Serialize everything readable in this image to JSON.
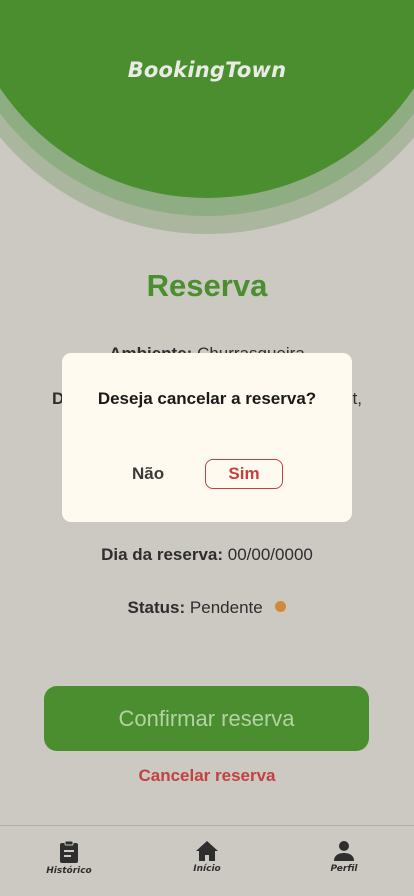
{
  "app": {
    "brand": "BookingTown"
  },
  "page": {
    "title": "Reserva"
  },
  "details": {
    "ambiente_label": "Ambiente:",
    "ambiente_value": "Churrasqueira",
    "data_label": "D",
    "data_value": "t,",
    "dia_label": "Dia da reserva:",
    "dia_value": "00/00/0000",
    "status_label": "Status:",
    "status_value": "Pendente",
    "status_color": "#d28a3a"
  },
  "actions": {
    "confirm_label": "Confirmar reserva",
    "cancel_label": "Cancelar reserva"
  },
  "modal": {
    "question": "Deseja cancelar a reserva?",
    "no_label": "Não",
    "yes_label": "Sim"
  },
  "nav": {
    "items": [
      {
        "label": "Histórico",
        "icon": "clipboard-icon"
      },
      {
        "label": "Início",
        "icon": "home-icon"
      },
      {
        "label": "Perfil",
        "icon": "person-icon"
      }
    ]
  },
  "colors": {
    "primary": "#4a8e30",
    "danger": "#c34141",
    "background": "#ccc8c2",
    "modal_bg": "#fffaef"
  }
}
